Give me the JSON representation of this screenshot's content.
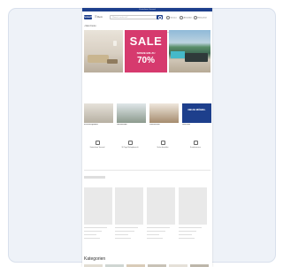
{
  "topbar": {
    "text": "Kostenloser Versand"
  },
  "header": {
    "logo": "home24",
    "menu_label": "Menü",
    "search_placeholder": "Wonach suchst du?",
    "links": [
      "Service",
      "Anmelden",
      "Merkzettel"
    ]
  },
  "breadcrumb": "‹ Mein Konto",
  "hero": {
    "sale_title": "SALE",
    "sale_subtitle": "SPARE BIS ZU",
    "sale_percent": "70%"
  },
  "categories": [
    {
      "label": "Einrichtungsideen"
    },
    {
      "label": "Gartenmöbel"
    },
    {
      "label": "Wohnzimmer"
    },
    {
      "label": "Neuheiten",
      "banner": "NEUE MÖBEL"
    }
  ],
  "usps": [
    "Kostenloser Versand",
    "30 Tage Rückgaberecht",
    "Sicher bezahlen",
    "Kundenservice"
  ],
  "kategorien_title": "Kategorien",
  "colors": {
    "brand": "#1d3f8c",
    "sale": "#d63a6e",
    "background_card": "#eef2f8"
  }
}
